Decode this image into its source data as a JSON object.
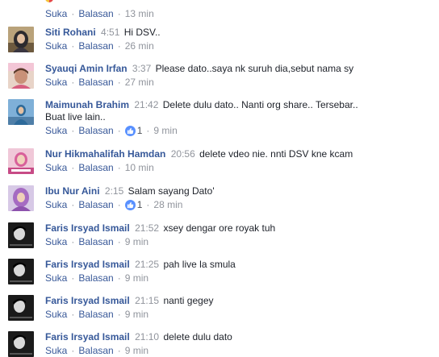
{
  "top_meta": {
    "like": "Suka",
    "reply": "Balasan",
    "time": "13 min"
  },
  "separator": "·",
  "comments": [
    {
      "author": "Siti Rohani",
      "time": "4:51",
      "text": "Hi DSV..",
      "text2": "",
      "like": "Suka",
      "reply": "Balasan",
      "reactions": "",
      "ago": "26 min"
    },
    {
      "author": "Syauqi Amin Irfan",
      "time": "3:37",
      "text": "Please dato..saya nk suruh dia,sebut nama sy",
      "text2": "",
      "like": "Suka",
      "reply": "Balasan",
      "reactions": "",
      "ago": "27 min"
    },
    {
      "author": "Maimunah Brahim",
      "time": "21:42",
      "text": "Delete dulu dato.. Nanti org share.. Tersebar..",
      "text2": "Buat live lain..",
      "like": "Suka",
      "reply": "Balasan",
      "reactions": "1",
      "ago": "9 min"
    },
    {
      "author": "Nur Hikmahalifah Hamdan",
      "time": "20:56",
      "text": "delete vdeo nie. nnti DSV kne kcam",
      "text2": "",
      "like": "Suka",
      "reply": "Balasan",
      "reactions": "",
      "ago": "10 min"
    },
    {
      "author": "Ibu Nur Aini",
      "time": "2:15",
      "text": "Salam sayang Dato'",
      "text2": "",
      "like": "Suka",
      "reply": "Balasan",
      "reactions": "1",
      "ago": "28 min"
    },
    {
      "author": "Faris Irsyad Ismail",
      "time": "21:52",
      "text": "xsey dengar ore royak tuh",
      "text2": "",
      "like": "Suka",
      "reply": "Balasan",
      "reactions": "",
      "ago": "9 min"
    },
    {
      "author": "Faris Irsyad Ismail",
      "time": "21:25",
      "text": "pah live la smula",
      "text2": "",
      "like": "Suka",
      "reply": "Balasan",
      "reactions": "",
      "ago": "9 min"
    },
    {
      "author": "Faris Irsyad Ismail",
      "time": "21:15",
      "text": "nanti gegey",
      "text2": "",
      "like": "Suka",
      "reply": "Balasan",
      "reactions": "",
      "ago": "9 min"
    },
    {
      "author": "Faris Irsyad Ismail",
      "time": "21:10",
      "text": "delete dulu dato",
      "text2": "",
      "like": "Suka",
      "reply": "Balasan",
      "reactions": "",
      "ago": "9 min"
    }
  ],
  "colors": {
    "author": "#365899",
    "link": "#385898",
    "muted": "#90949c",
    "text": "#1d2129",
    "like_badge": "#5890ff"
  },
  "icons": {
    "reaction": "thumbs-up-icon",
    "avatar": "user-avatar"
  }
}
